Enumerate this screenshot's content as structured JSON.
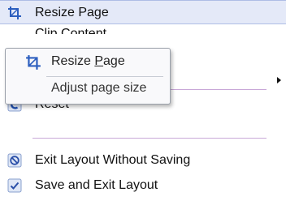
{
  "menu": {
    "items": [
      {
        "label": "Resize Page",
        "icon": "crop-resize-icon",
        "highlighted": true
      },
      {
        "label": "Clip Content",
        "icon": "clip-icon"
      },
      {
        "label": "Reset",
        "icon": "reset-icon"
      },
      {
        "label": "Exit Layout Without Saving",
        "icon": "cancel-icon"
      },
      {
        "label": "Save and Exit Layout",
        "icon": "save-check-icon"
      }
    ]
  },
  "tooltip": {
    "title_prefix": "Resize ",
    "title_accel": "P",
    "title_suffix": "age",
    "description": "Adjust page size"
  },
  "colors": {
    "highlight_bg": "#e4e9f8",
    "highlight_border": "#aebde6",
    "separator": "#c9a8d8",
    "icon_blue": "#2d5fbf"
  }
}
